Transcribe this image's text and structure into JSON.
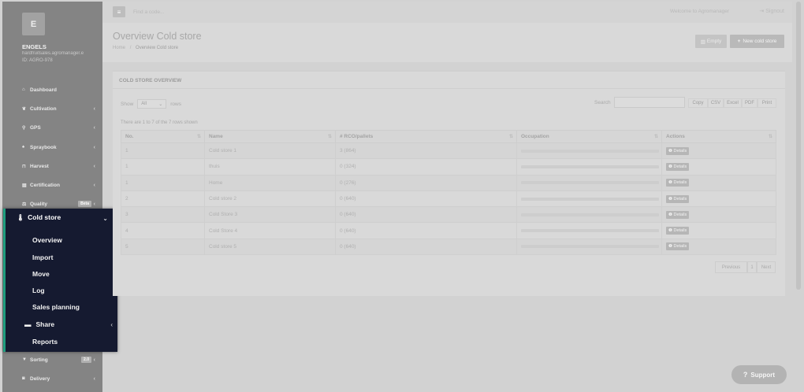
{
  "sidebar": {
    "avatar_letter": "E",
    "user_name": "ENGELS",
    "user_email": "hardfruitsales.agromanager.e",
    "user_id": "ID: AGRO-978",
    "items": [
      {
        "icon": "home-icon",
        "glyph": "⌂",
        "label": "Dashboard",
        "chevron": ""
      },
      {
        "icon": "leaf-icon",
        "glyph": "❦",
        "label": "Cultivation",
        "chevron": "‹"
      },
      {
        "icon": "map-pin-icon",
        "glyph": "⚲",
        "label": "GPS",
        "chevron": "‹"
      },
      {
        "icon": "spray-icon",
        "glyph": "♠",
        "label": "Spraybook",
        "chevron": "‹"
      },
      {
        "icon": "basket-icon",
        "glyph": "⊓",
        "label": "Harvest",
        "chevron": "‹"
      },
      {
        "icon": "certificate-icon",
        "glyph": "▤",
        "label": "Certification",
        "chevron": "‹"
      },
      {
        "icon": "quality-icon",
        "glyph": "⚖",
        "label": "Quality",
        "badge": "Beta",
        "chevron": "‹"
      },
      {
        "icon": "filter-icon",
        "glyph": "▼",
        "label": "Sorting",
        "badge": "2.0",
        "chevron": "‹"
      },
      {
        "icon": "truck-icon",
        "glyph": "◙",
        "label": "Delivery",
        "chevron": "‹"
      }
    ]
  },
  "submenu": {
    "title": "Cold store",
    "icon": "thermometer-icon",
    "chevron": "⌄",
    "items": [
      {
        "label": "Overview"
      },
      {
        "label": "Import"
      },
      {
        "label": "Move"
      },
      {
        "label": "Log"
      },
      {
        "label": "Sales planning"
      },
      {
        "label": "Share",
        "icon": "folder-icon",
        "chevron": "‹"
      },
      {
        "label": "Reports"
      }
    ]
  },
  "topbar": {
    "search_placeholder": "Find a code...",
    "welcome": "Welcome to Agromanager",
    "signout": "Signout"
  },
  "header": {
    "title": "Overview Cold store",
    "breadcrumb_home": "Home",
    "breadcrumb_sep": "/",
    "breadcrumb_current": "Overview Cold store",
    "empty_label": "Empty",
    "new_label": "New cold store"
  },
  "card": {
    "title": "COLD STORE OVERVIEW",
    "show_label": "Show",
    "show_value": "All",
    "rows_label": "rows",
    "search_label": "Search",
    "export_buttons": [
      "Copy",
      "CSV",
      "Excel",
      "PDF",
      "Print"
    ],
    "info": "There are 1 to 7 of the 7 rows shown",
    "columns": [
      "No.",
      "Name",
      "# RCO/pallets",
      "Occupation",
      "Actions"
    ],
    "rows": [
      {
        "no": "1",
        "name": "Cold store 1",
        "pallets": "3 (864)",
        "action": "Details"
      },
      {
        "no": "1",
        "name": "thuis",
        "pallets": "0 (324)",
        "action": "Details"
      },
      {
        "no": "1",
        "name": "Home",
        "pallets": "0 (276)",
        "action": "Details"
      },
      {
        "no": "2",
        "name": "Cold store 2",
        "pallets": "0 (640)",
        "action": "Details"
      },
      {
        "no": "3",
        "name": "Cold Store 3",
        "pallets": "0 (640)",
        "action": "Details"
      },
      {
        "no": "4",
        "name": "Cold Store 4",
        "pallets": "0 (640)",
        "action": "Details"
      },
      {
        "no": "5",
        "name": "Cold store 5",
        "pallets": "0 (640)",
        "action": "Details"
      }
    ],
    "pager": {
      "previous": "Previous",
      "page": "1",
      "next": "Next"
    }
  },
  "support_label": "Support",
  "colors": {
    "submenu_bg": "#151a30",
    "accent": "#1e9e7e"
  }
}
